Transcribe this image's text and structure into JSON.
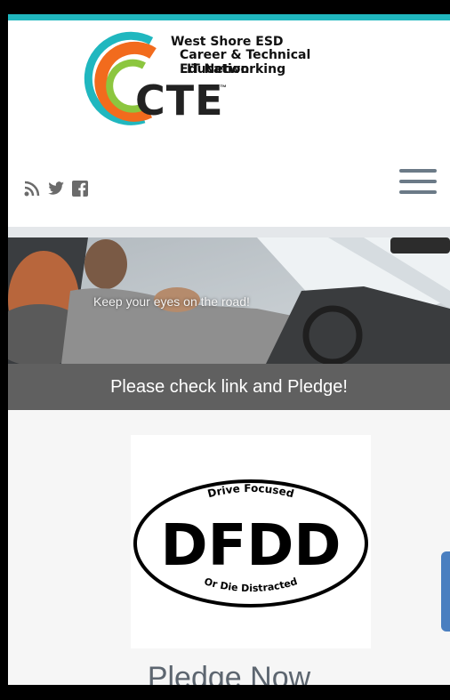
{
  "header": {
    "org_line1": "West Shore ESD",
    "org_line2": "Career & Technical Education",
    "org_line3": "IT Networking",
    "logo_text": "CTE",
    "trademark": "™"
  },
  "social": {
    "icons": [
      "rss-icon",
      "twitter-icon",
      "facebook-icon"
    ]
  },
  "menu": {
    "icon": "hamburger-menu-icon"
  },
  "hero": {
    "caption": "Keep your eyes on the road!"
  },
  "banner": {
    "text": "Please check link and Pledge!"
  },
  "dfdd": {
    "top_arc": "Drive Focused",
    "big": "DFDD",
    "bottom_arc": "Or Die Distracted"
  },
  "cta": {
    "label": "Pledge Now"
  },
  "colors": {
    "teal": "#20b7bf",
    "orange": "#f26b1d",
    "green": "#8cc63f",
    "banner_gray": "#606060",
    "icon_gray": "#6b7a87"
  }
}
